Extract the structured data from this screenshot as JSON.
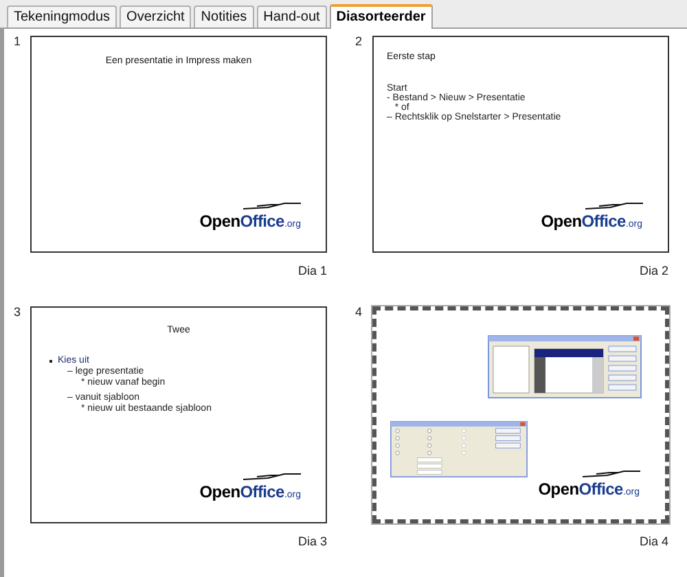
{
  "tabs": [
    {
      "label": "Tekeningmodus",
      "selected": false
    },
    {
      "label": "Overzicht",
      "selected": false
    },
    {
      "label": "Notities",
      "selected": false
    },
    {
      "label": "Hand-out",
      "selected": false
    },
    {
      "label": "Diasorteerder",
      "selected": true
    }
  ],
  "slides": [
    {
      "number": "1",
      "kind": "title",
      "selected": false,
      "title": "Een presentatie in Impress maken",
      "logo": [
        "Open",
        "Office",
        ".org"
      ],
      "caption": "Dia 1"
    },
    {
      "number": "2",
      "kind": "text",
      "selected": false,
      "title": "Eerste stap",
      "lines": [
        "Start",
        "- Bestand > Nieuw > Presentatie",
        "   * of",
        "– Rechtsklik op Snelstarter > Presentatie"
      ],
      "logo": [
        "Open",
        "Office",
        ".org"
      ],
      "caption": "Dia 2"
    },
    {
      "number": "3",
      "kind": "bullets",
      "selected": false,
      "title": "Twee",
      "bullets": [
        {
          "text": "Kies uit",
          "children": [
            {
              "text": "– lege presentatie",
              "children": [
                {
                  "text": "* nieuw vanaf begin"
                }
              ]
            },
            {
              "text": "– vanuit sjabloon",
              "children": [
                {
                  "text": "* nieuw uit bestaande sjabloon"
                }
              ]
            }
          ]
        }
      ],
      "logo": [
        "Open",
        "Office",
        ".org"
      ],
      "caption": "Dia 3"
    },
    {
      "number": "4",
      "kind": "screenshots",
      "selected": true,
      "logo": [
        "Open",
        "Office",
        ".org"
      ],
      "caption": "Dia 4"
    }
  ]
}
